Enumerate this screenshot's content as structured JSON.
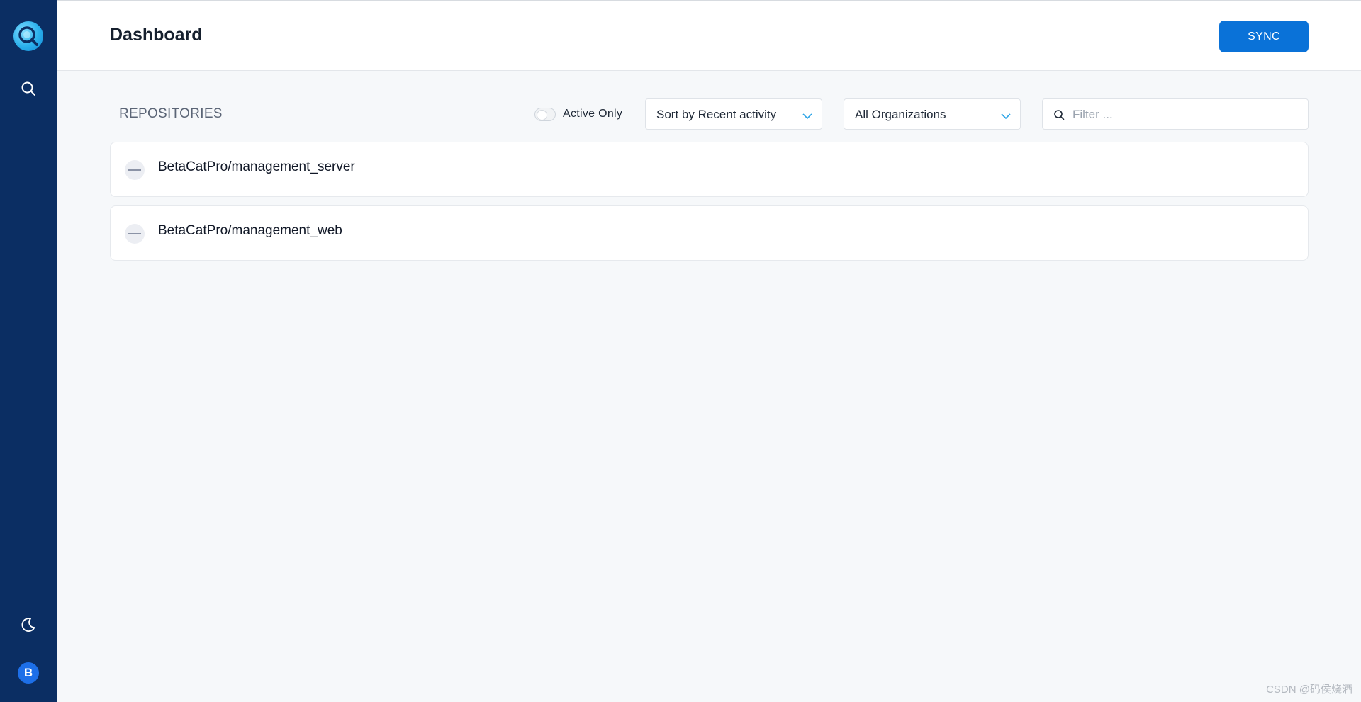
{
  "sidebar": {
    "logo_icon": "logo-icon",
    "search_icon": "search-icon",
    "theme_icon": "moon-icon",
    "avatar_initial": "B",
    "avatar_color": "#1d6fe8",
    "background": "#0b2e63"
  },
  "header": {
    "title": "Dashboard",
    "sync_label": "SYNC",
    "sync_color": "#0a72d8"
  },
  "toolbar": {
    "section_title": "REPOSITORIES",
    "active_only_label": "Active Only",
    "active_only_checked": false,
    "sort_selected": "Sort by Recent activity",
    "org_selected": "All Organizations",
    "filter_placeholder": "Filter ..."
  },
  "repositories": [
    {
      "name": "BetaCatPro/management_server",
      "status_icon": "minus-icon"
    },
    {
      "name": "BetaCatPro/management_web",
      "status_icon": "minus-icon"
    }
  ],
  "watermark": "CSDN @码侯烧酒"
}
